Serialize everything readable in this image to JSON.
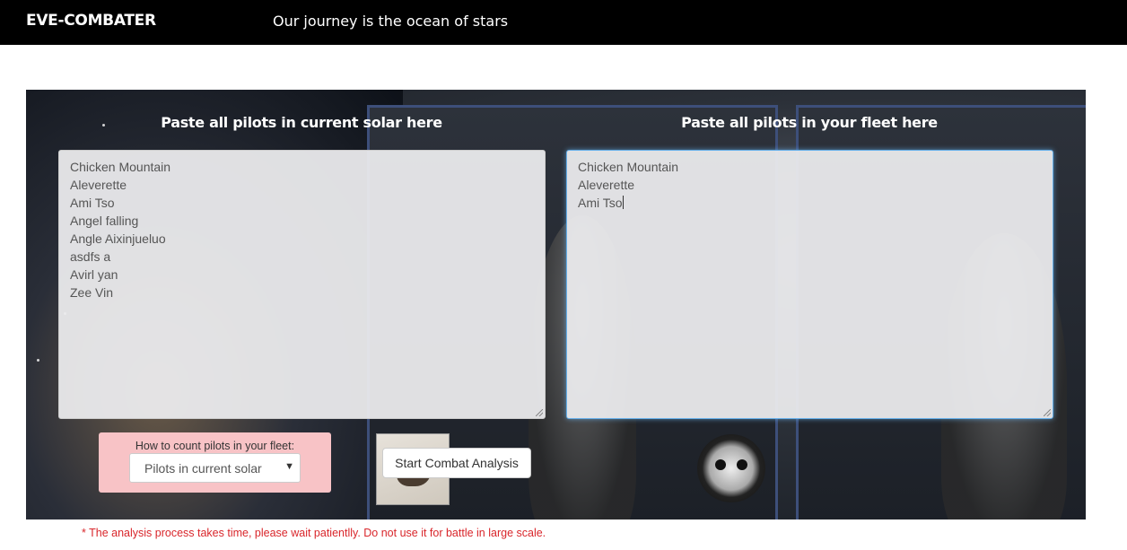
{
  "header": {
    "brand": "EVE-COMBATER",
    "tagline": "Our journey is the ocean of stars"
  },
  "left_panel": {
    "title": "Paste all pilots in current solar here",
    "pilots": [
      "Chicken Mountain",
      "Aleverette",
      "Ami Tso",
      "Angel falling",
      "Angle Aixinjueluo",
      "asdfs a",
      "Avirl yan",
      "Zee Vin"
    ]
  },
  "right_panel": {
    "title": "Paste all pilots in your fleet here",
    "pilots": [
      "Chicken Mountain",
      "Aleverette",
      "Ami Tso"
    ]
  },
  "count_mode": {
    "label": "How to count pilots in your fleet:",
    "selected": "Pilots in current solar"
  },
  "actions": {
    "start_label": "Start Combat Analysis"
  },
  "notice": "* The analysis process takes time, please wait patientlly. Do not use it for battle in large scale.",
  "colors": {
    "header_bg": "#000000",
    "count_panel_bg": "#f8c3c6",
    "notice_color": "#d9262b",
    "focus_border": "#66afe9"
  }
}
